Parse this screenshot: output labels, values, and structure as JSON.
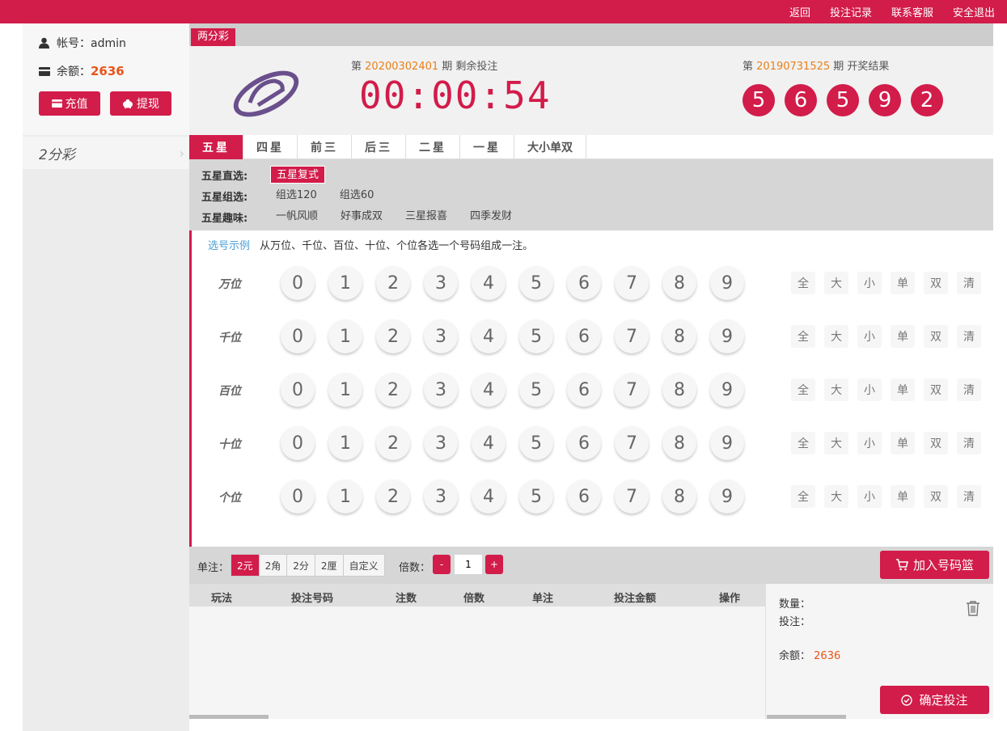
{
  "topnav": [
    "返回",
    "投注记录",
    "联系客服",
    "安全退出"
  ],
  "account": {
    "user_label": "帐号：admin",
    "balance_label": "余额：",
    "balance_value": "2636",
    "recharge_label": "充值",
    "withdraw_label": "提现"
  },
  "sidebar": {
    "game": "2分彩"
  },
  "game_tag": "两分彩",
  "current": {
    "prefix": "第",
    "period": "20200302401",
    "suffix": "期 剩余投注",
    "timer": "00:00:54"
  },
  "last": {
    "prefix": "第",
    "period": "20190731525",
    "suffix": "期 开奖结果",
    "balls": [
      "5",
      "6",
      "5",
      "9",
      "2"
    ]
  },
  "tabs": [
    "五星",
    "四星",
    "前三",
    "后三",
    "二星",
    "一星",
    "大小单双"
  ],
  "sub": [
    {
      "label": "五星直选:",
      "options": [
        "五星复式"
      ]
    },
    {
      "label": "五星组选:",
      "options": [
        "组选120",
        "组选60"
      ]
    },
    {
      "label": "五星趣味:",
      "options": [
        "一帆风顺",
        "好事成双",
        "三星报喜",
        "四季发财"
      ]
    }
  ],
  "tip": {
    "link": "选号示例",
    "text": "从万位、千位、百位、十位、个位各选一个号码组成一注。"
  },
  "positions": [
    "万位",
    "千位",
    "百位",
    "十位",
    "个位"
  ],
  "digits": [
    "0",
    "1",
    "2",
    "3",
    "4",
    "5",
    "6",
    "7",
    "8",
    "9"
  ],
  "quick": [
    "全",
    "大",
    "小",
    "单",
    "双",
    "清"
  ],
  "betbar": {
    "unit_label": "单注：",
    "units": [
      "2元",
      "2角",
      "2分",
      "2厘",
      "自定义"
    ],
    "mult_label": "倍数：",
    "minus": "-",
    "plus": "+",
    "mult_value": "1",
    "add_label": "加入号码篮"
  },
  "table": {
    "headers": [
      "玩法",
      "投注号码",
      "注数",
      "倍数",
      "单注",
      "投注金额",
      "操作"
    ]
  },
  "summary": {
    "count_label": "数量：",
    "bet_label": "投注：",
    "balance_label": "余额：",
    "balance_value": "2636",
    "confirm_label": "确定投注"
  },
  "colors": {
    "accent": "#d21c4a",
    "highlight": "#e8801a"
  }
}
